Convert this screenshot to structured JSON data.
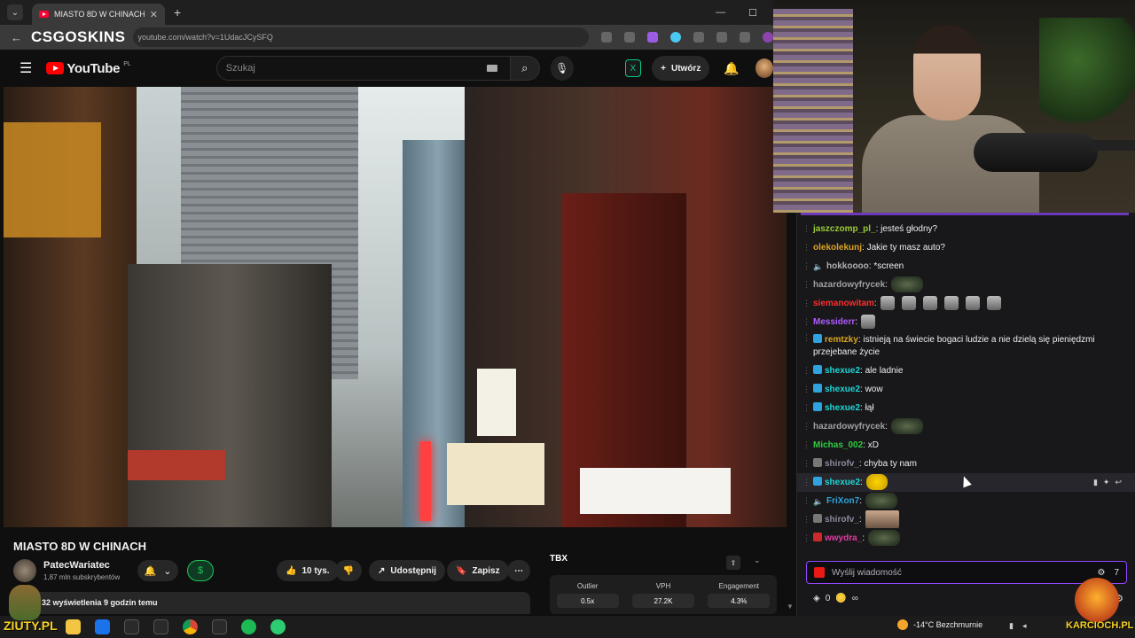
{
  "browser": {
    "tab_title": "MIASTO 8D W CHINACH - YouTube",
    "new_tab": "+",
    "url": "youtube.com/watch?v=1UdacJCySFQ",
    "overlay_logo": "CSGOSKINS"
  },
  "youtube": {
    "logo_text": "YouTube",
    "logo_region": "PL",
    "search_placeholder": "Szukaj",
    "create_label": "Utwórz"
  },
  "video": {
    "title": "MIASTO 8D W CHINACH",
    "channel_name": "PatecWariatec",
    "subscribers": "1,87 mln subskrybentów",
    "likes": "10 tys.",
    "share_label": "Udostępnij",
    "save_label": "Zapisz",
    "views_line": "32 wyświetlenia  9 godzin temu"
  },
  "tubestats": {
    "logo": "TBX",
    "cols": [
      {
        "label": "Outlier",
        "value": "0.5x"
      },
      {
        "label": "VPH",
        "value": "27.2K"
      },
      {
        "label": "Engagement",
        "value": "4.3%"
      }
    ]
  },
  "chat": {
    "messages": [
      {
        "user": "jaszczomp_pl_",
        "color": "#9acd32",
        "text": ": jesteś głodny?",
        "badge": "none"
      },
      {
        "user": "olekolekunj",
        "color": "#daa520",
        "text": ": Jakie ty masz auto?",
        "badge": "none"
      },
      {
        "user": "hokkoooo",
        "color": "#b0b0b0",
        "text": ": *screen",
        "badge": "mute"
      },
      {
        "user": "hazardowyfrycek",
        "color": "#a0a0a0",
        "text": ":",
        "badge": "none",
        "emote": "frog"
      },
      {
        "user": "siemanowitam",
        "color": "#ff2d2d",
        "text": ":",
        "badge": "none",
        "emote": "multi"
      },
      {
        "user": "Messiderr",
        "color": "#b05cff",
        "text": ":",
        "badge": "none",
        "emote": "small"
      },
      {
        "user": "remtzky",
        "color": "#daa520",
        "text": ": istnieją na świecie bogaci ludzie a nie dzielą się pieniędzmi przejebane życie",
        "badge": "sub",
        "wrap": true
      },
      {
        "user": "shexue2",
        "color": "#1fd6d6",
        "text": ": ale ladnie",
        "badge": "sub"
      },
      {
        "user": "shexue2",
        "color": "#1fd6d6",
        "text": ": wow",
        "badge": "sub"
      },
      {
        "user": "shexue2",
        "color": "#1fd6d6",
        "text": ": łął",
        "badge": "sub"
      },
      {
        "user": "hazardowyfrycek",
        "color": "#a0a0a0",
        "text": ":",
        "badge": "none",
        "emote": "frog"
      },
      {
        "user": "Michas_002",
        "color": "#2ecc40",
        "text": ": xD",
        "badge": "none"
      },
      {
        "user": "shirofv_",
        "color": "#8a8a9a",
        "text": ": chyba ty nam",
        "badge": "gray"
      },
      {
        "user": "shexue2",
        "color": "#1fd6d6",
        "text": ":",
        "badge": "sub",
        "emote": "yellow",
        "highlight": true
      },
      {
        "user": "FriXon7",
        "color": "#2fa3dd",
        "text": ":",
        "badge": "mute",
        "emote": "frog"
      },
      {
        "user": "shirofv_",
        "color": "#8a8a9a",
        "text": ":",
        "badge": "gray",
        "emote": "face"
      },
      {
        "user": "wwydra_",
        "color": "#e03ca0",
        "text": ":",
        "badge": "red",
        "emote": "frog"
      }
    ],
    "input_placeholder": "Wyślij wiadomość",
    "points": "0",
    "infinity": "∞"
  },
  "taskbar": {
    "weather": "-14°C  Bezchmurnie"
  },
  "overlays": {
    "left_brand": "ZIUTY.PL",
    "right_brand": "KARCIOCH.PL"
  }
}
